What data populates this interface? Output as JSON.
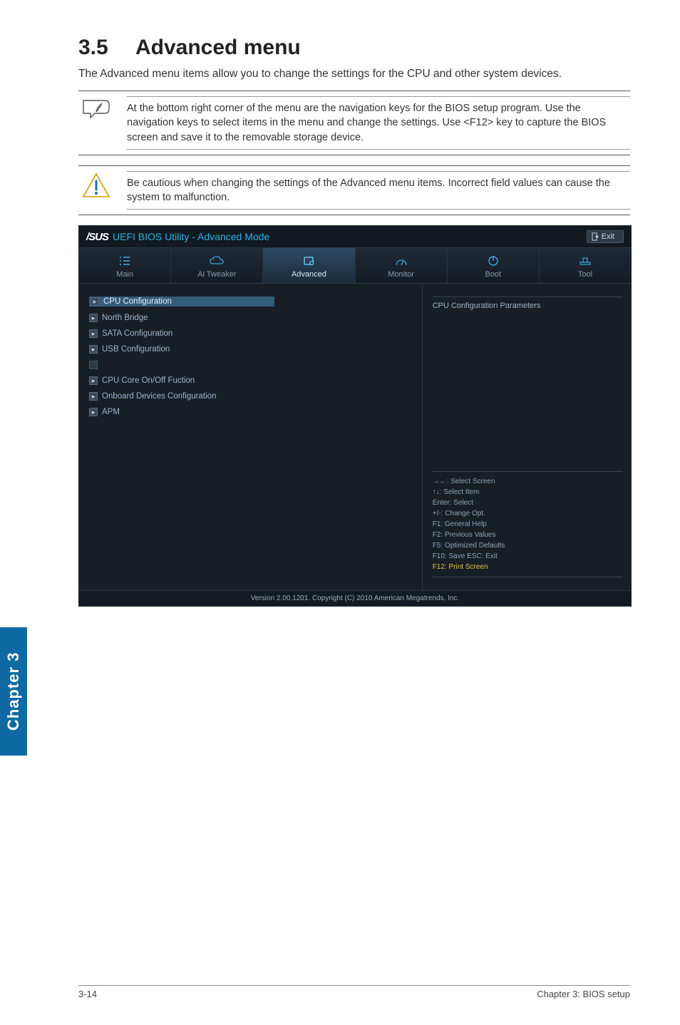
{
  "heading_num": "3.5",
  "heading_text": "Advanced menu",
  "intro": "The Advanced menu items allow you to change the settings for the CPU and other system devices.",
  "note1": "At the bottom right corner of the menu are the navigation keys for the BIOS setup program. Use the navigation keys to select items in the menu and change the settings. Use <F12> key to capture the BIOS screen and save it to the removable storage device.",
  "note2": "Be cautious when changing the settings of the Advanced menu items. Incorrect field values can cause the system to malfunction.",
  "bios": {
    "logo": "/SUS",
    "title": "UEFI BIOS Utility - Advanced Mode",
    "exit": "Exit",
    "tabs": [
      "Main",
      "Ai  Tweaker",
      "Advanced",
      "Monitor",
      "Boot",
      "Tool"
    ],
    "menu": [
      {
        "label": "CPU Configuration",
        "selected": true
      },
      {
        "label": "North Bridge"
      },
      {
        "label": "SATA Configuration"
      },
      {
        "label": "USB Configuration"
      },
      {
        "label": "CPU Core On/Off Fuction",
        "pre": "sq"
      },
      {
        "label": "Onboard Devices Configuration"
      },
      {
        "label": "APM"
      }
    ],
    "right_title": "CPU Configuration Parameters",
    "help": [
      "→←:  Select Screen",
      "↑↓:  Select Item",
      "Enter:  Select",
      "+/-:  Change Opt.",
      "F1:  General Help",
      "F2:  Previous Values",
      "F5:  Optimized Defaults",
      "F10:  Save   ESC:  Exit",
      "F12:  Print Screen"
    ],
    "footer": "Version  2.00.1201.   Copyright  (C)  2010  American  Megatrends,  Inc."
  },
  "side_tab": "Chapter 3",
  "page_left": "3-14",
  "page_right": "Chapter 3: BIOS setup"
}
